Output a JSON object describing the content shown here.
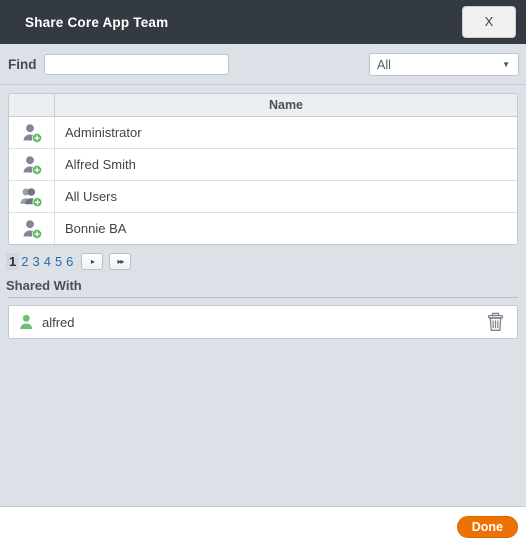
{
  "titlebar": {
    "title": "Share Core App Team",
    "close_label": "X"
  },
  "findbar": {
    "label": "Find",
    "input_value": "",
    "input_placeholder": "",
    "filter_selected": "All",
    "filter_caret": "▼"
  },
  "people_table": {
    "columns": [
      "",
      "Name"
    ],
    "rows": [
      {
        "icon": "user-add-icon",
        "name": "Administrator"
      },
      {
        "icon": "user-add-icon",
        "name": "Alfred Smith"
      },
      {
        "icon": "group-add-icon",
        "name": "All Users"
      },
      {
        "icon": "user-add-icon",
        "name": "Bonnie BA"
      }
    ]
  },
  "pager": {
    "pages": [
      "1",
      "2",
      "3",
      "4",
      "5",
      "6"
    ],
    "active_page": "1",
    "next_label": "▸",
    "last_label": "▸▸"
  },
  "shared_with": {
    "title": "Shared With",
    "entries": [
      {
        "icon": "user-icon",
        "name": "alfred",
        "delete_icon": "trash-icon"
      }
    ]
  },
  "footer": {
    "done_label": "Done"
  },
  "colors": {
    "titlebar_bg": "#343a42",
    "body_bg": "#dce1e8",
    "accent_orange": "#ee7203",
    "link_blue": "#2b6ca3",
    "icon_green": "#5cb860",
    "icon_gray": "#818892"
  }
}
